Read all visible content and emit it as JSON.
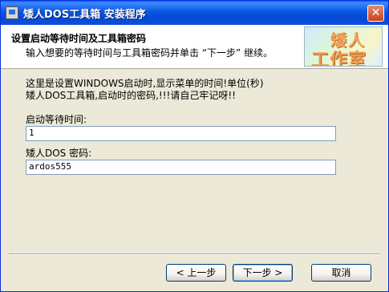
{
  "window": {
    "title": "矮人DOS工具箱 安装程序",
    "close_glyph": "✕"
  },
  "header": {
    "title": "设置启动等待时间及工具箱密码",
    "subtitle": "输入想要的等待时间与工具箱密码并单击 “下一步” 继续。",
    "logo_line1": "矮人",
    "logo_line2": "工作室"
  },
  "body": {
    "info": "这里是设置WINDOWS启动时,显示菜单的时间!单位(秒)\n矮人DOS工具箱,启动时的密码,!!!请自己牢记呀!!",
    "wait_label": "启动等待时间:",
    "wait_value": "1",
    "password_label": "矮人DOS 密码:",
    "password_value": "ardos555"
  },
  "buttons": {
    "back": "< 上一步",
    "next": "下一步 >",
    "cancel": "取消"
  }
}
